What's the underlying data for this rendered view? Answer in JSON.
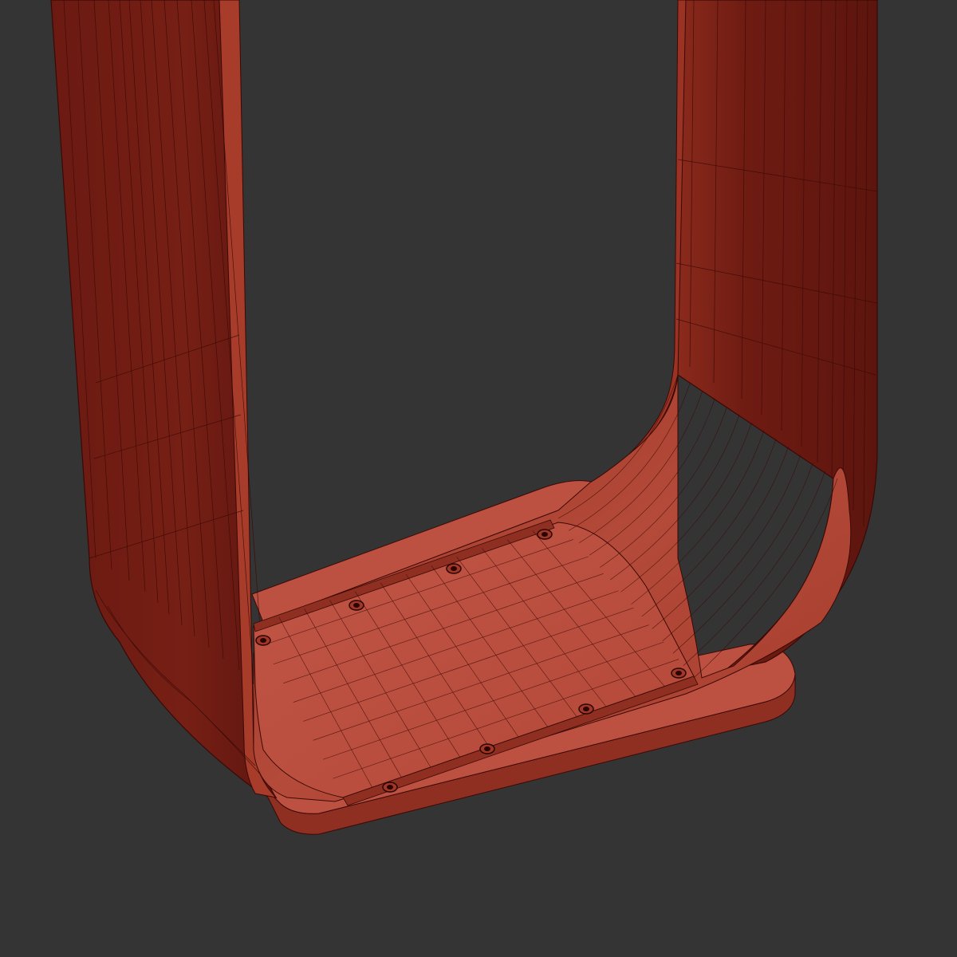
{
  "viewport": {
    "background": "#343434"
  },
  "model": {
    "colors": {
      "outer_face": "#6b1a12",
      "outer_face_light": "#7e2217",
      "inner_face": "#a3392a",
      "inner_face_light": "#b94c3a",
      "floor": "#ba4f3f",
      "base_top": "#bd5141",
      "base_side": "#8e2f22",
      "wire": "#3a0905",
      "screw": "#2a0503"
    },
    "screw_count": 8
  }
}
